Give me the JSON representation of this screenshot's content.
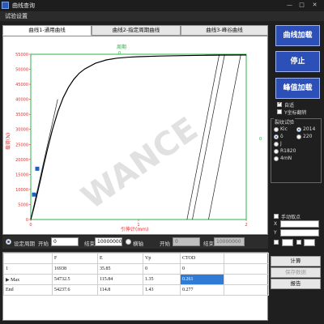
{
  "window": {
    "title": "曲线查询",
    "minimize_glyph": "—",
    "maximize_glyph": "□",
    "close_glyph": "✕"
  },
  "menu": {
    "item": "试验设置"
  },
  "tabs": [
    {
      "label": "曲线1-通用曲线",
      "active": true
    },
    {
      "label": "曲线2-指定周期曲线",
      "active": false
    },
    {
      "label": "曲线3-峰谷曲线",
      "active": false
    }
  ],
  "watermark": "WANCE",
  "chart_data": {
    "type": "line",
    "title": "周期",
    "title_value": "0",
    "xlabel": "引伸计(mm)",
    "ylabel": "载荷(N)",
    "y_right_label": "0",
    "xlim": [
      0,
      2
    ],
    "ylim": [
      0,
      55000
    ],
    "x_ticks": [
      "0",
      "1",
      "2"
    ],
    "y_ticks": [
      "0",
      "5000",
      "10000",
      "15000",
      "20000",
      "25000",
      "30000",
      "35000",
      "40000",
      "45000",
      "50000",
      "55000"
    ],
    "colors": {
      "curve": "#000000",
      "axes": "#e03030",
      "frame": "#2fb04a",
      "markers": "#1f5fbf"
    },
    "series": [
      {
        "x": [
          0.0,
          0.03,
          0.06,
          0.09,
          0.12,
          0.15,
          0.2,
          0.25,
          0.3,
          0.35,
          0.4,
          0.45,
          0.5,
          0.6,
          0.7,
          0.8,
          0.9,
          1.0,
          1.2,
          1.4,
          1.6,
          1.8,
          2.0
        ],
        "values": [
          0,
          4100,
          8600,
          13200,
          18100,
          22700,
          29800,
          35800,
          40500,
          44000,
          46700,
          48700,
          50100,
          52000,
          53100,
          53700,
          54000,
          54200,
          54400,
          54550,
          54650,
          54720,
          54750
        ]
      }
    ],
    "markers": [
      {
        "x": 0.03,
        "y": 8300
      },
      {
        "x": 0.06,
        "y": 16900
      }
    ],
    "guide_lines": [
      {
        "from": [
          0.0,
          0
        ],
        "to": [
          0.25,
          40000
        ]
      },
      {
        "from": [
          1.45,
          0
        ],
        "to": [
          1.75,
          55000
        ]
      },
      {
        "from": [
          1.5,
          0
        ],
        "to": [
          1.8,
          55000
        ]
      },
      {
        "from": [
          1.65,
          0
        ],
        "to": [
          1.95,
          55000
        ]
      }
    ]
  },
  "params": {
    "period_label": "设定周期",
    "start_label": "开始",
    "start_value": "0",
    "end_label": "结束",
    "end_value": "10000000",
    "cursor_label": "横轴",
    "start2_label": "开始",
    "start2_value": "0",
    "end2_label": "结束",
    "end2_value": "10000000"
  },
  "results": {
    "headers": [
      "",
      "F",
      "E",
      "Vp",
      "CTOD"
    ],
    "rows": [
      [
        "1",
        "16938",
        "35.85",
        "0",
        "0"
      ],
      [
        "Max",
        "54732.5",
        "115.84",
        "1.35",
        "0.261"
      ],
      [
        "End",
        "54237.6",
        "114.8",
        "1.43",
        "0.277"
      ]
    ]
  },
  "side": {
    "load_curve": "曲线加载",
    "stop": "停止",
    "peak_load": "峰值加载",
    "autoscale": "自适",
    "zero_label": "Y坐标翻转",
    "group_title": "裂纹试验",
    "radio_options": [
      "Kic",
      "δ",
      "J",
      "R1820",
      "4mN"
    ],
    "radio_options_2": [
      "2014",
      "220"
    ],
    "manual_label": "手动取点",
    "x_label": "X",
    "y_label": "Y",
    "calc": "计算",
    "save_data": "保存数据",
    "report": "报告"
  }
}
